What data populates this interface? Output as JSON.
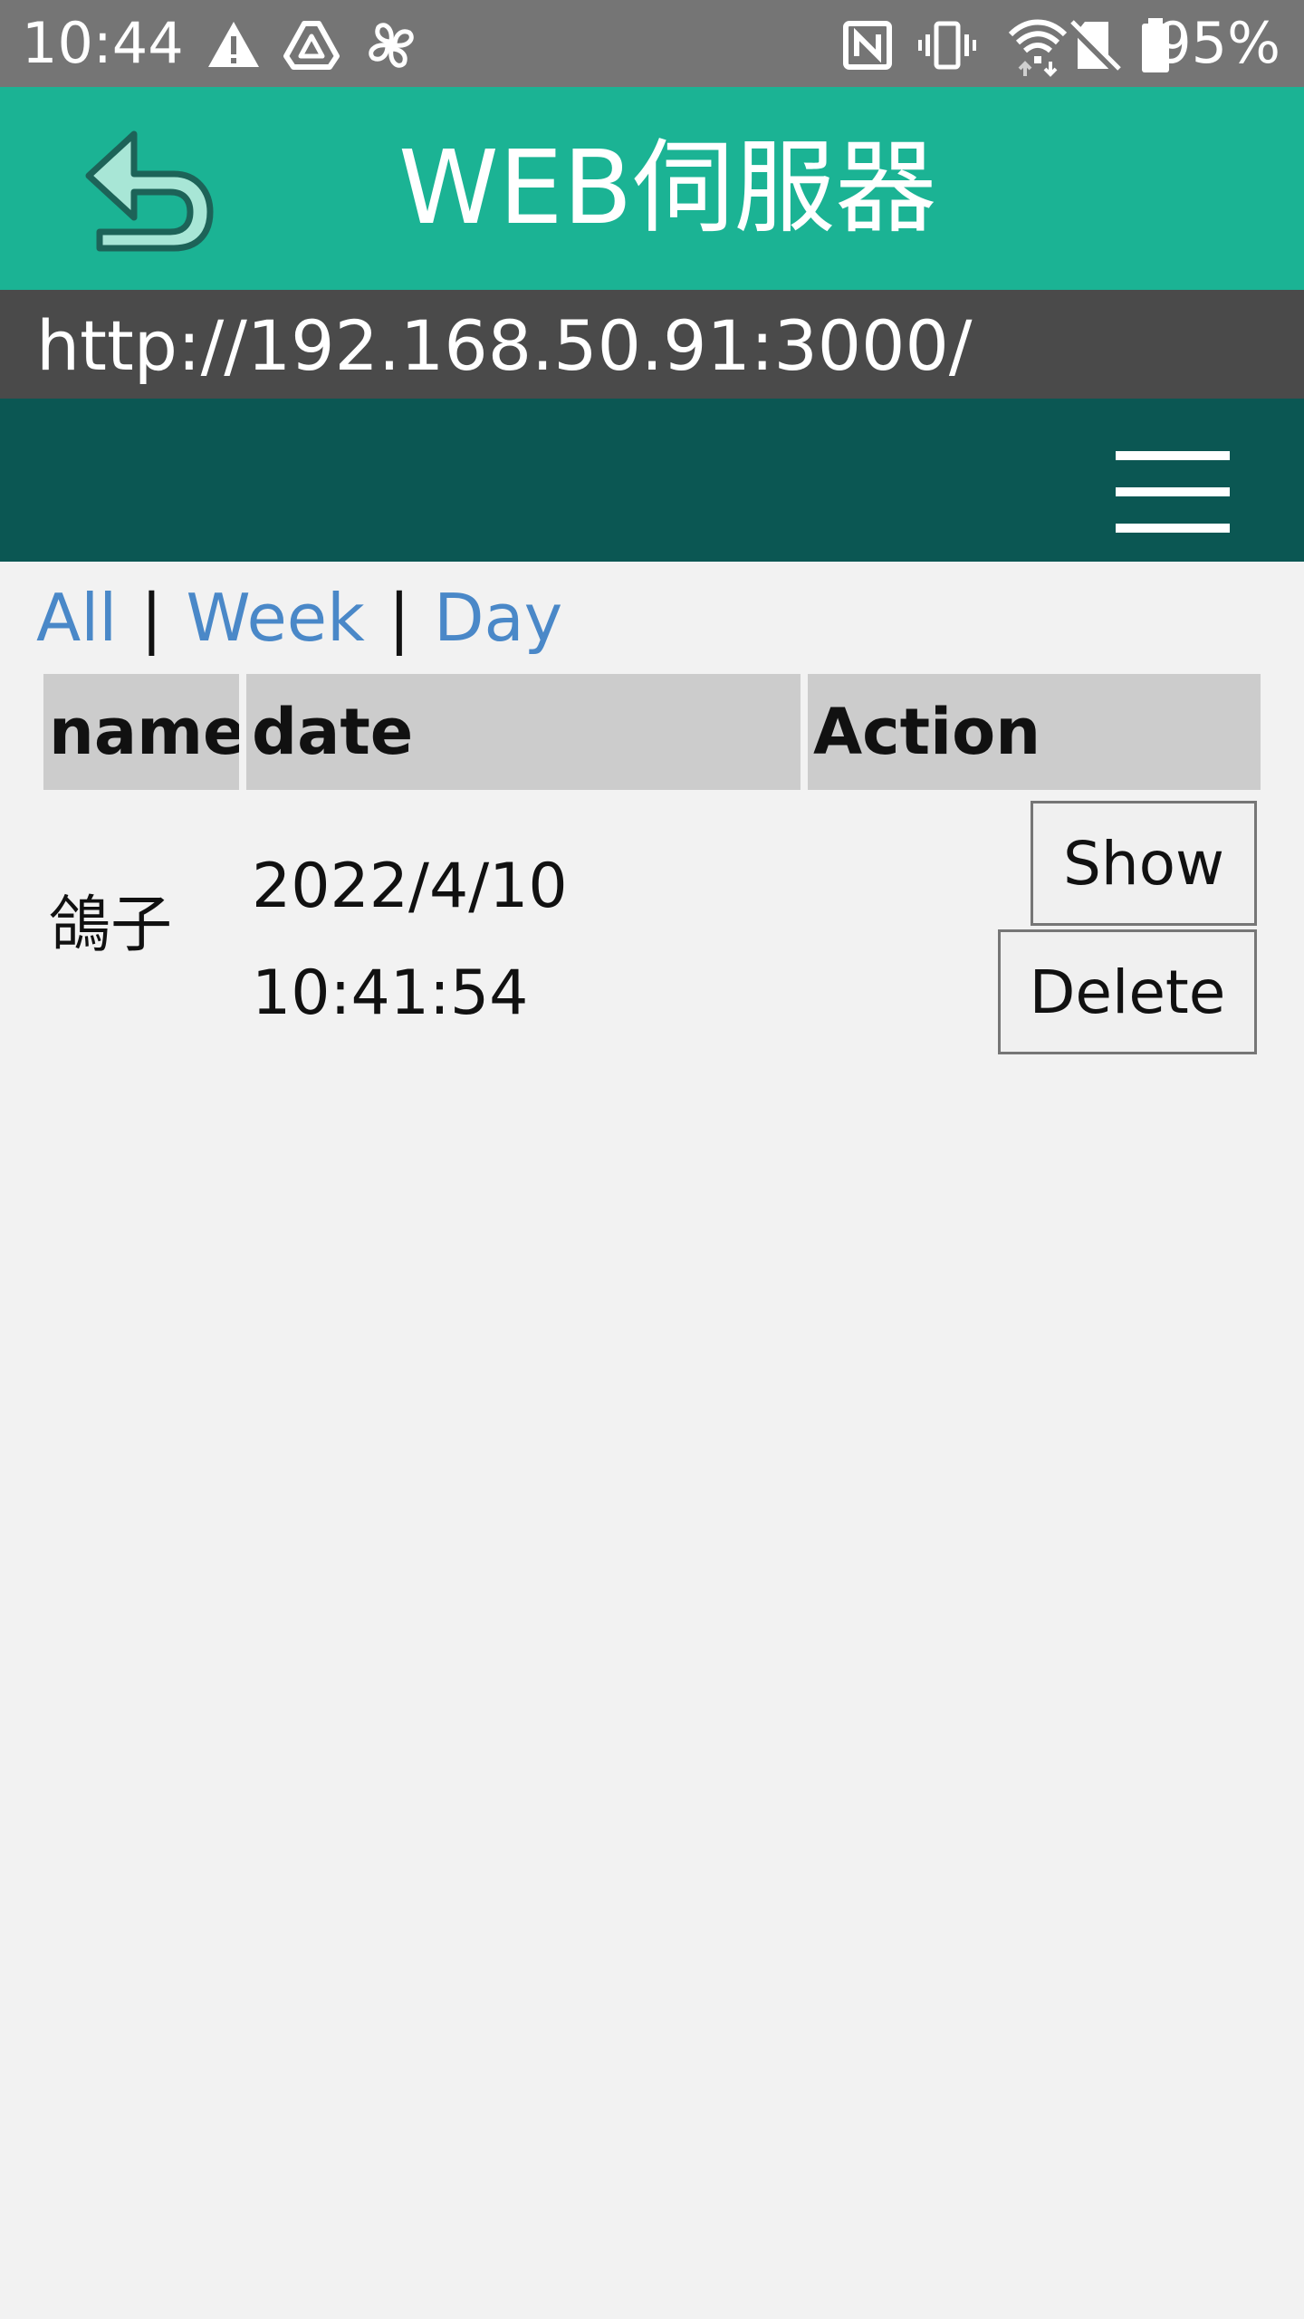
{
  "status_bar": {
    "time": "10:44",
    "battery": "95%",
    "icons": [
      "warning-icon",
      "drive-icon",
      "fan-icon",
      "nfc-icon",
      "vibrate-icon",
      "wifi-icon",
      "no-sim-icon",
      "battery-icon"
    ]
  },
  "app_bar": {
    "title": "WEB伺服器",
    "back_icon": "back-arrow-icon",
    "accent": "#1bb394"
  },
  "url_bar": {
    "url": "http://192.168.50.91:3000/"
  },
  "web_nav": {
    "menu_icon": "hamburger-menu-icon",
    "color": "#0b5753"
  },
  "filters": {
    "all": "All",
    "week": "Week",
    "day": "Day",
    "separator": "|"
  },
  "table": {
    "headers": [
      "name",
      "date",
      "Action"
    ],
    "rows": [
      {
        "name": "鴿子",
        "date_line1": "2022/4/10",
        "date_line2": "10:41:54",
        "show_label": "Show",
        "delete_label": "Delete"
      }
    ]
  }
}
